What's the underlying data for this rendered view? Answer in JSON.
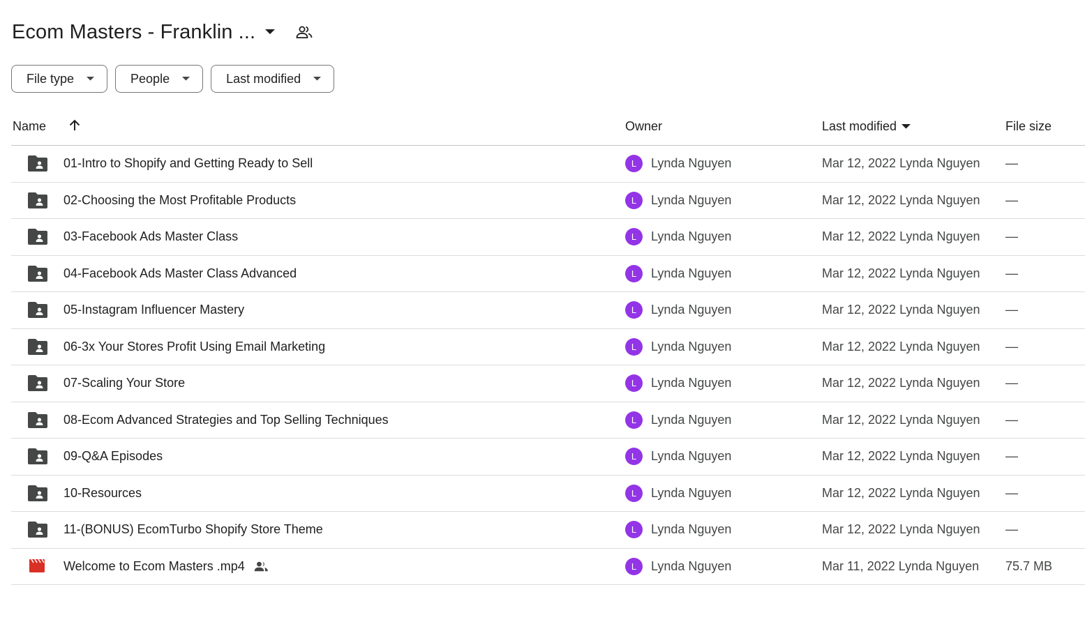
{
  "folder_title": "Ecom Masters - Franklin ...",
  "filters": [
    {
      "label": "File type"
    },
    {
      "label": "People"
    },
    {
      "label": "Last modified"
    }
  ],
  "columns": {
    "name": "Name",
    "owner": "Owner",
    "last_modified": "Last modified",
    "file_size": "File size"
  },
  "colors": {
    "avatar": "#9334e6",
    "folder_icon": "#444746",
    "video_icon": "#d93025"
  },
  "rows": [
    {
      "name": "01-Intro to Shopify and Getting Ready to Sell",
      "icon": "shared-folder-icon",
      "avatar": "L",
      "owner": "Lynda Nguyen",
      "modified": "Mar 12, 2022 Lynda Nguyen",
      "size": "—"
    },
    {
      "name": "02-Choosing the Most Profitable Products",
      "icon": "shared-folder-icon",
      "avatar": "L",
      "owner": "Lynda Nguyen",
      "modified": "Mar 12, 2022 Lynda Nguyen",
      "size": "—"
    },
    {
      "name": "03-Facebook Ads Master Class",
      "icon": "shared-folder-icon",
      "avatar": "L",
      "owner": "Lynda Nguyen",
      "modified": "Mar 12, 2022 Lynda Nguyen",
      "size": "—"
    },
    {
      "name": "04-Facebook Ads Master Class Advanced",
      "icon": "shared-folder-icon",
      "avatar": "L",
      "owner": "Lynda Nguyen",
      "modified": "Mar 12, 2022 Lynda Nguyen",
      "size": "—"
    },
    {
      "name": "05-Instagram Influencer Mastery",
      "icon": "shared-folder-icon",
      "avatar": "L",
      "owner": "Lynda Nguyen",
      "modified": "Mar 12, 2022 Lynda Nguyen",
      "size": "—"
    },
    {
      "name": "06-3x Your Stores Profit Using Email Marketing",
      "icon": "shared-folder-icon",
      "avatar": "L",
      "owner": "Lynda Nguyen",
      "modified": "Mar 12, 2022 Lynda Nguyen",
      "size": "—"
    },
    {
      "name": "07-Scaling Your Store",
      "icon": "shared-folder-icon",
      "avatar": "L",
      "owner": "Lynda Nguyen",
      "modified": "Mar 12, 2022 Lynda Nguyen",
      "size": "—"
    },
    {
      "name": "08-Ecom Advanced Strategies and Top Selling Techniques",
      "icon": "shared-folder-icon",
      "avatar": "L",
      "owner": "Lynda Nguyen",
      "modified": "Mar 12, 2022 Lynda Nguyen",
      "size": "—"
    },
    {
      "name": "09-Q&A Episodes",
      "icon": "shared-folder-icon",
      "avatar": "L",
      "owner": "Lynda Nguyen",
      "modified": "Mar 12, 2022 Lynda Nguyen",
      "size": "—"
    },
    {
      "name": "10-Resources",
      "icon": "shared-folder-icon",
      "avatar": "L",
      "owner": "Lynda Nguyen",
      "modified": "Mar 12, 2022 Lynda Nguyen",
      "size": "—"
    },
    {
      "name": "11-(BONUS) EcomTurbo Shopify Store Theme",
      "icon": "shared-folder-icon",
      "avatar": "L",
      "owner": "Lynda Nguyen",
      "modified": "Mar 12, 2022 Lynda Nguyen",
      "size": "—"
    },
    {
      "name": "Welcome to Ecom Masters .mp4",
      "icon": "video-file-icon",
      "shared": true,
      "avatar": "L",
      "owner": "Lynda Nguyen",
      "modified": "Mar 11, 2022 Lynda Nguyen",
      "size": "75.7 MB"
    }
  ]
}
